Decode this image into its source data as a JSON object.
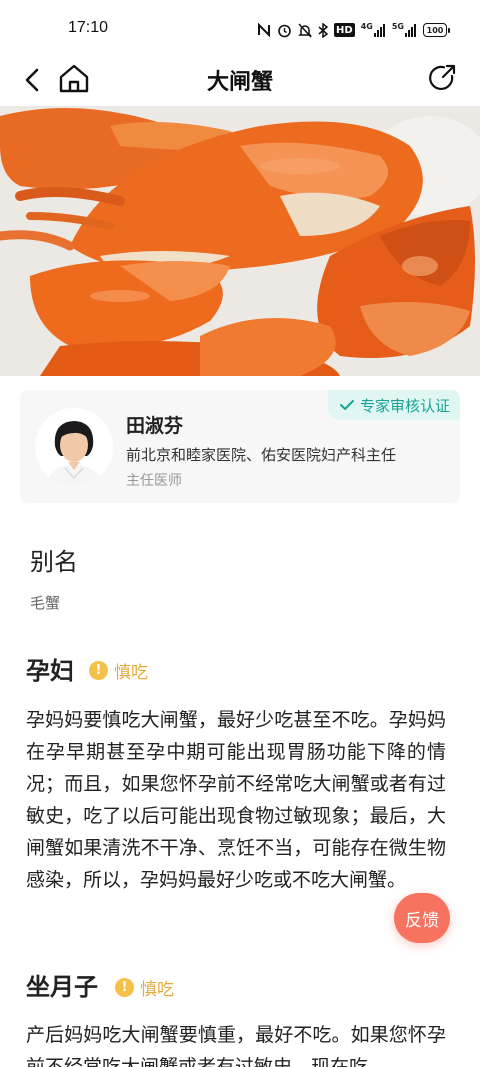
{
  "status_bar": {
    "time": "17:10",
    "network_4g": "4G",
    "network_5g": "5G",
    "hd_label": "HD",
    "battery": "100"
  },
  "nav": {
    "title": "大闸蟹"
  },
  "hero": {
    "image_description_icon": "crab-photo"
  },
  "expert": {
    "badge": "专家审核认证",
    "name": "田淑芬",
    "hospital": "前北京和睦家医院、佑安医院妇产科主任",
    "title": "主任医师"
  },
  "alias": {
    "heading": "别名",
    "value": "毛蟹"
  },
  "sections": [
    {
      "heading": "孕妇",
      "level": "慎吃",
      "text": "孕妈妈要慎吃大闸蟹，最好少吃甚至不吃。孕妈妈在孕早期甚至孕中期可能出现胃肠功能下降的情况；而且，如果您怀孕前不经常吃大闸蟹或者有过敏史，吃了以后可能出现食物过敏现象；最后，大闸蟹如果清洗不干净、烹饪不当，可能存在微生物感染，所以，孕妈妈最好少吃或不吃大闸蟹。"
    },
    {
      "heading": "坐月子",
      "level": "慎吃",
      "text": "产后妈妈吃大闸蟹要慎重，最好不吃。如果您怀孕前不经常吃大闸蟹或者有过敏史，现在吃"
    }
  ],
  "feedback": {
    "label": "反馈"
  },
  "colors": {
    "accent_teal": "#1aa394",
    "caution_yellow": "#f5c04a",
    "feedback_red": "#f7735f"
  }
}
